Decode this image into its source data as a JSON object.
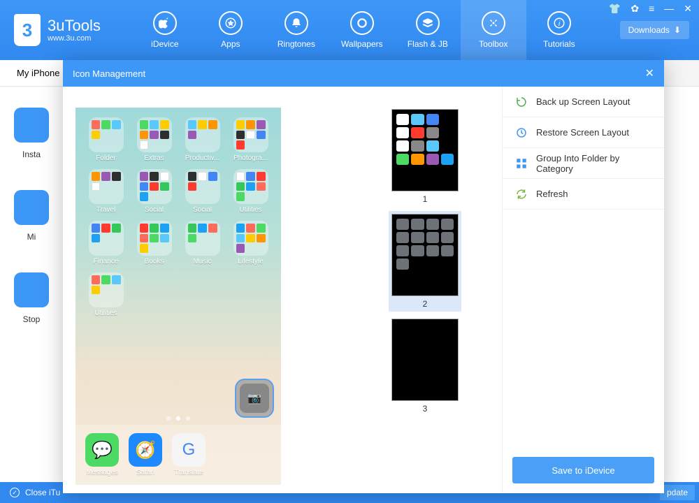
{
  "app": {
    "name": "3uTools",
    "subtitle": "www.3u.com"
  },
  "nav": {
    "items": [
      {
        "label": "iDevice"
      },
      {
        "label": "Apps"
      },
      {
        "label": "Ringtones"
      },
      {
        "label": "Wallpapers"
      },
      {
        "label": "Flash & JB"
      },
      {
        "label": "Toolbox",
        "active": true
      },
      {
        "label": "Tutorials"
      }
    ]
  },
  "downloads_label": "Downloads",
  "tab_label": "My iPhone",
  "side_items": [
    {
      "label": "Insta"
    },
    {
      "label": "Mi"
    },
    {
      "label": "Stop"
    }
  ],
  "status": {
    "text": "Close iTu",
    "right_button": "pdate"
  },
  "modal": {
    "title": "Icon Management",
    "folders": [
      "Folder",
      "Extras",
      "Productiv...",
      "Photogra...",
      "Travel",
      "Social",
      "Social",
      "Utilities",
      "Finance",
      "Books",
      "Music",
      "Lifestyle",
      "Utilities"
    ],
    "dock": [
      {
        "label": "Messages",
        "color": "#4cd964"
      },
      {
        "label": "Safari",
        "color": "#1e88ff"
      },
      {
        "label": "Translate",
        "color": "#f5f5f5"
      }
    ],
    "selected_icon_label": "Camera",
    "pages": [
      "1",
      "2",
      "3"
    ],
    "active_page": 2,
    "actions": [
      {
        "label": "Back up Screen Layout",
        "icon": "backup"
      },
      {
        "label": "Restore Screen Layout",
        "icon": "restore"
      },
      {
        "label": "Group Into Folder by Category",
        "icon": "group"
      },
      {
        "label": "Refresh",
        "icon": "refresh"
      }
    ],
    "save_label": "Save to iDevice"
  }
}
